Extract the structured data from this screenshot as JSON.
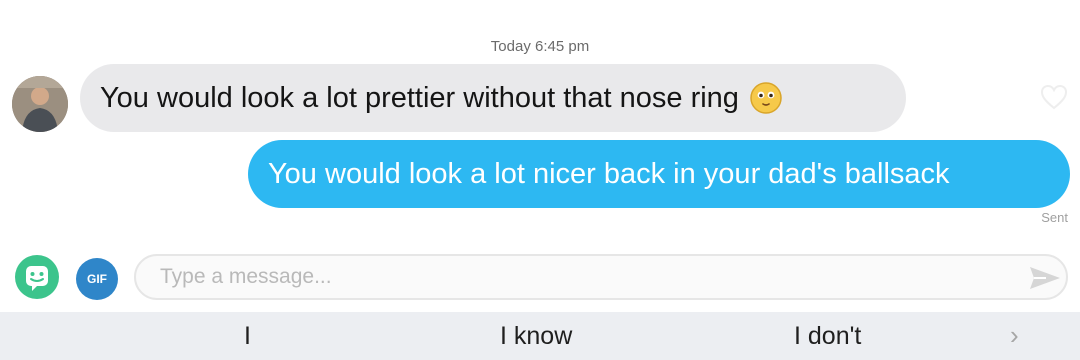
{
  "thread": {
    "timestamp": "Today 6:45 pm",
    "messages": [
      {
        "direction": "incoming",
        "text": "You would look a lot prettier without that nose ring",
        "emoji": "emoji-face-icon"
      },
      {
        "direction": "outgoing",
        "text": "You would look a lot nicer back in your dad's ballsack"
      }
    ],
    "sent_label": "Sent"
  },
  "composer": {
    "gif_label": "GIF",
    "placeholder": "Type a message..."
  },
  "keyboard": {
    "suggestions": [
      "I",
      "I know",
      "I don't"
    ]
  },
  "colors": {
    "incoming_bubble": "#e9e9eb",
    "outgoing_bubble": "#2db8f2",
    "sticker_green": "#3cc48c",
    "gif_blue": "#2f86c9"
  }
}
